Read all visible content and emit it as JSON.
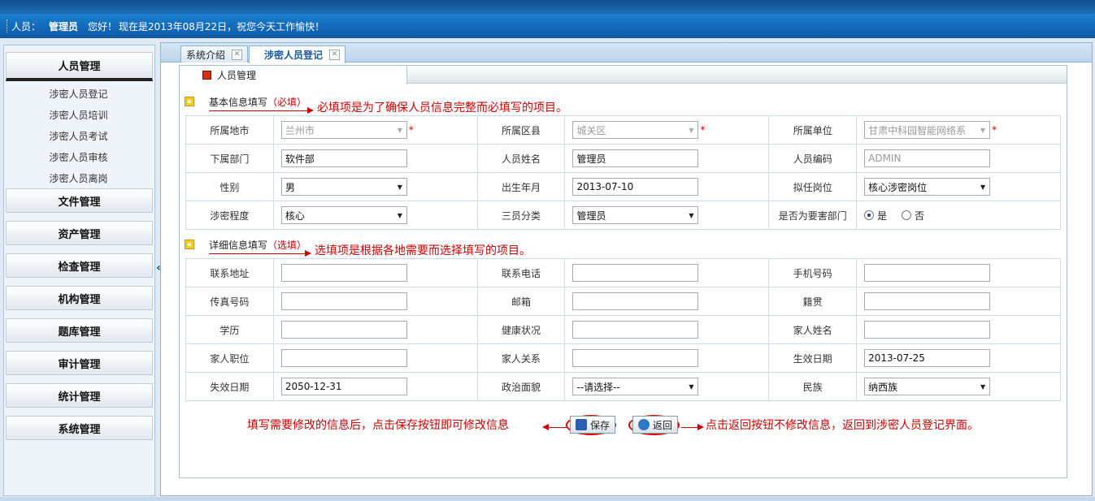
{
  "header": {
    "user_label": "人员：",
    "user_name": "管理员",
    "greeting": "您好！",
    "message": "现在是2013年08月22日，祝您今天工作愉快！"
  },
  "sidebar": {
    "sections": [
      {
        "label": "人员管理",
        "active": true
      },
      {
        "label": "文件管理"
      },
      {
        "label": "资产管理"
      },
      {
        "label": "检查管理"
      },
      {
        "label": "机构管理"
      },
      {
        "label": "题库管理"
      },
      {
        "label": "审计管理"
      },
      {
        "label": "统计管理"
      },
      {
        "label": "系统管理"
      }
    ],
    "items": [
      "涉密人员登记",
      "涉密人员培训",
      "涉密人员考试",
      "涉密人员审核",
      "涉密人员离岗"
    ],
    "collapse_glyph": "«"
  },
  "tabs": [
    {
      "label": "系统介绍"
    },
    {
      "label": "涉密人员登记",
      "active": true
    }
  ],
  "panel": {
    "title": "人员管理",
    "basic_section": {
      "label": "基本信息填写",
      "tag": "（必填）"
    },
    "detail_section": {
      "label": "详细信息填写",
      "tag": "（选填）"
    },
    "basic_rows": [
      [
        {
          "label": "所属地市",
          "type": "select",
          "value": "兰州市",
          "disabled": true,
          "required": true
        },
        {
          "label": "所属区县",
          "type": "select",
          "value": "城关区",
          "disabled": true,
          "required": true
        },
        {
          "label": "所属单位",
          "type": "select",
          "value": "甘肃中科园智能网络系",
          "disabled": true,
          "required": true
        }
      ],
      [
        {
          "label": "下属部门",
          "type": "input",
          "value": "软件部"
        },
        {
          "label": "人员姓名",
          "type": "input",
          "value": "管理员"
        },
        {
          "label": "人员编码",
          "type": "input",
          "value": "ADMIN",
          "disabled": true
        }
      ],
      [
        {
          "label": "性别",
          "type": "select",
          "value": "男"
        },
        {
          "label": "出生年月",
          "type": "input",
          "value": "2013-07-10"
        },
        {
          "label": "拟任岗位",
          "type": "select",
          "value": "核心涉密岗位"
        }
      ],
      [
        {
          "label": "涉密程度",
          "type": "select",
          "value": "核心"
        },
        {
          "label": "三员分类",
          "type": "select",
          "value": "管理员"
        },
        {
          "label": "是否为要害部门",
          "type": "radio",
          "options": [
            "是",
            "否"
          ],
          "selected": "是"
        }
      ]
    ],
    "detail_rows": [
      [
        {
          "label": "联系地址",
          "type": "input",
          "value": ""
        },
        {
          "label": "联系电话",
          "type": "input",
          "value": ""
        },
        {
          "label": "手机号码",
          "type": "input",
          "value": ""
        }
      ],
      [
        {
          "label": "传真号码",
          "type": "input",
          "value": ""
        },
        {
          "label": "邮箱",
          "type": "input",
          "value": ""
        },
        {
          "label": "籍贯",
          "type": "input",
          "value": ""
        }
      ],
      [
        {
          "label": "学历",
          "type": "input",
          "value": ""
        },
        {
          "label": "健康状况",
          "type": "input",
          "value": ""
        },
        {
          "label": "家人姓名",
          "type": "input",
          "value": ""
        }
      ],
      [
        {
          "label": "家人职位",
          "type": "input",
          "value": ""
        },
        {
          "label": "家人关系",
          "type": "input",
          "value": ""
        },
        {
          "label": "生效日期",
          "type": "input",
          "value": "2013-07-25"
        }
      ],
      [
        {
          "label": "失效日期",
          "type": "input",
          "value": "2050-12-31"
        },
        {
          "label": "政治面貌",
          "type": "select",
          "value": "--请选择--"
        },
        {
          "label": "民族",
          "type": "select",
          "value": "纳西族"
        }
      ]
    ],
    "buttons": {
      "save": "保存",
      "back": "返回"
    }
  },
  "annotations": {
    "required_note": "必填项是为了确保人员信息完整而必填写的项目。",
    "optional_note": "选填项是根据各地需要而选择填写的项目。",
    "save_note": "填写需要修改的信息后，点击保存按钮即可修改信息",
    "back_note": "点击返回按钮不修改信息，返回到涉密人员登记界面。"
  },
  "colors": {
    "accent": "#1a7fd0",
    "annotation": "#cc0000"
  }
}
